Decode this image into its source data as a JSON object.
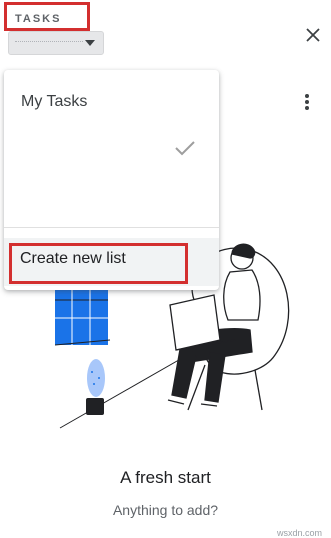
{
  "header": {
    "title": "TASKS",
    "list_selector": {
      "value": "",
      "icon": "caret-down-icon"
    },
    "close_icon": "close-icon"
  },
  "list_menu": {
    "items": [
      {
        "label": "My Tasks"
      },
      {
        "label": "",
        "selected": true,
        "icon": "check-icon"
      }
    ],
    "create_label": "Create new list"
  },
  "more_icon": "more-vertical-icon",
  "empty_state": {
    "title": "A fresh start",
    "subtitle": "Anything to add?"
  },
  "watermark": "wsxdn.com",
  "colors": {
    "highlight": "#d32f2f",
    "window_blue": "#1a73e8"
  }
}
